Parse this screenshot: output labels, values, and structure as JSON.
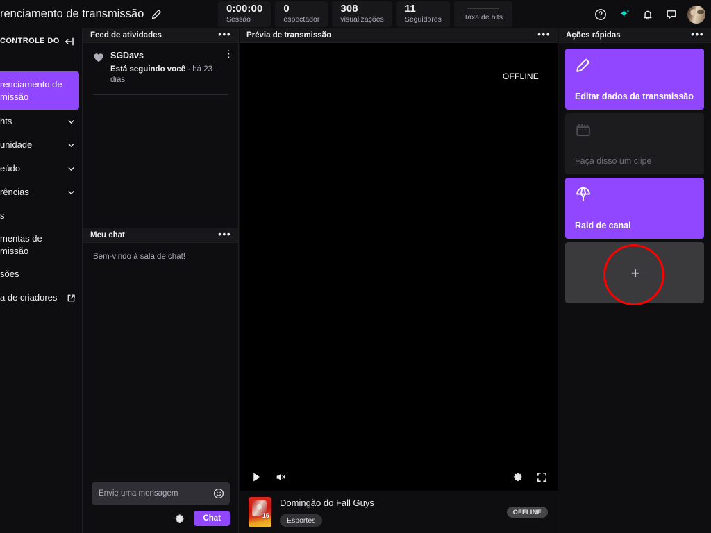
{
  "header": {
    "title": "renciamento de transmissão",
    "edit_icon": "pencil-icon",
    "stats": [
      {
        "value": "0:00:00",
        "label": "Sessão"
      },
      {
        "value": "0",
        "label": "espectador"
      },
      {
        "value": "308",
        "label": "visualizações"
      },
      {
        "value": "11",
        "label": "Seguidores"
      }
    ],
    "bitrate_label": "Taxa de bits",
    "icons": [
      "help-icon",
      "sparkle-icon",
      "bell-icon",
      "chat-bubble-icon",
      "avatar"
    ]
  },
  "sidebar": {
    "section_title": "CONTROLE DO",
    "collapse_icon": "collapse-sidebar-icon",
    "items": [
      {
        "label": "renciamento de\nmissão",
        "active": true,
        "chevron": false
      },
      {
        "label": "hts",
        "active": false,
        "chevron": true
      },
      {
        "label": "unidade",
        "active": false,
        "chevron": true
      },
      {
        "label": "eúdo",
        "active": false,
        "chevron": true
      },
      {
        "label": "rências",
        "active": false,
        "chevron": true
      },
      {
        "label": "s",
        "active": false,
        "chevron": false
      },
      {
        "label": "mentas de\nmissão",
        "active": false,
        "chevron": false
      },
      {
        "label": "sões",
        "active": false,
        "chevron": false
      },
      {
        "label": "a de criadores",
        "active": false,
        "chevron": false,
        "external": true
      }
    ]
  },
  "activity_feed": {
    "title": "Feed de atividades",
    "menu_icon": "more-options-icon",
    "entries": [
      {
        "icon": "heart-icon",
        "user": "SGDavs",
        "action": "Está seguindo você",
        "separator": " · ",
        "time": "há 23 dias",
        "row_menu": "row-more-icon"
      }
    ]
  },
  "my_chat": {
    "title": "Meu chat",
    "menu_icon": "more-options-icon",
    "welcome": "Bem-vindo à sala de chat!",
    "input_placeholder": "Envie uma mensagem",
    "emoji_icon": "smiley-icon",
    "settings_icon": "gear-icon",
    "send_label": "Chat"
  },
  "preview": {
    "title": "Prévia de transmissão",
    "menu_icon": "more-options-icon",
    "offline_text": "OFFLINE",
    "controls": [
      "play-icon",
      "mute-icon",
      "settings-gear-icon",
      "fullscreen-icon"
    ],
    "stream": {
      "title": "Domingão do Fall Guys",
      "category": "Esportes",
      "status": "OFFLINE",
      "thumbnail": "game-box-art"
    }
  },
  "quick_actions": {
    "title": "Ações rápidas",
    "menu_icon": "more-options-icon",
    "cards": [
      {
        "label": "Editar dados da transmissão",
        "icon": "pencil-icon",
        "style": "purple"
      },
      {
        "label": "Faça disso um clipe",
        "icon": "clapperboard-icon",
        "style": "dim"
      },
      {
        "label": "Raid de canal",
        "icon": "parachute-icon",
        "style": "purple"
      },
      {
        "label": "+",
        "icon": "plus-icon",
        "style": "add"
      }
    ]
  },
  "annotation": {
    "shape": "circle",
    "color": "#fe0000"
  }
}
